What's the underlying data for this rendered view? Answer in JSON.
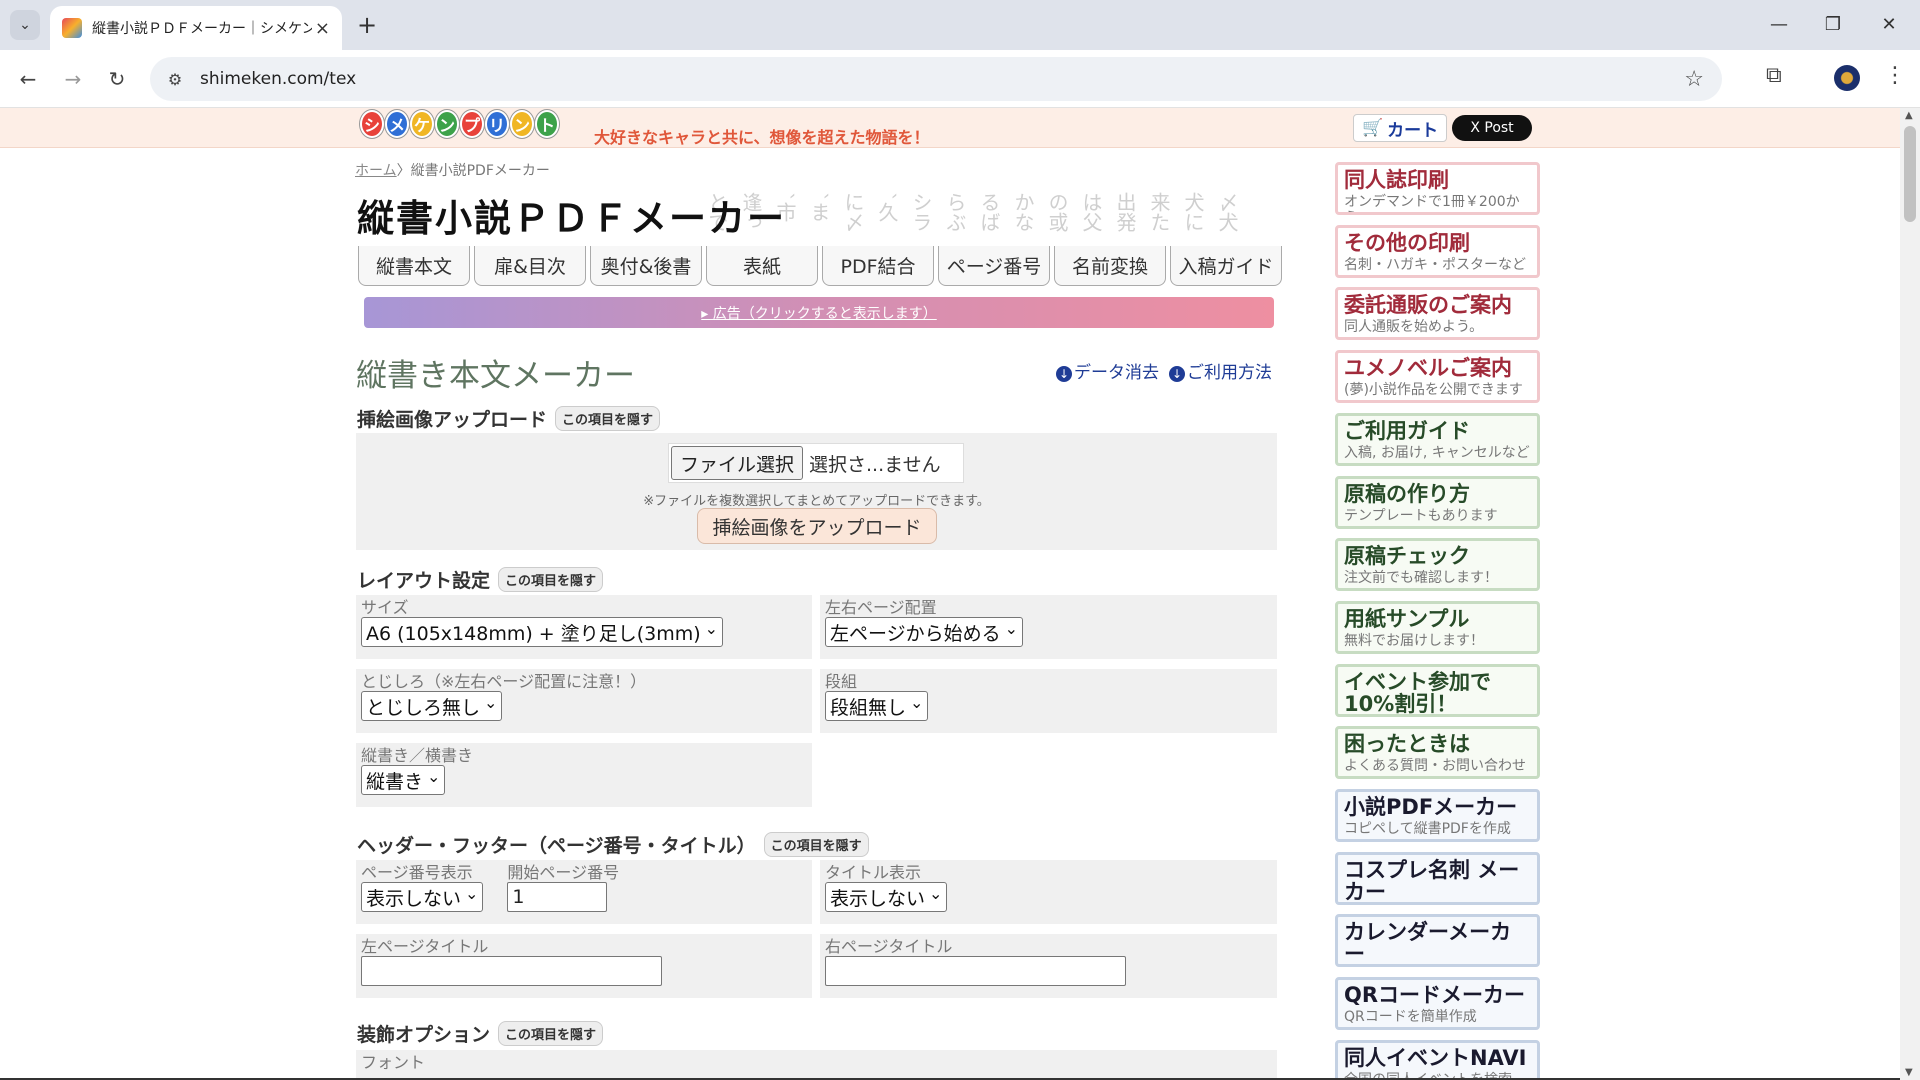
{
  "browser": {
    "tab_title": "縦書小説ＰＤＦメーカー｜シメケン",
    "url": "shimeken.com/tex"
  },
  "header": {
    "logo_letters": [
      "シ",
      "メ",
      "ケ",
      "ン",
      "プ",
      "リ",
      "ン",
      "ト"
    ],
    "logo_colors": [
      "#e8423a",
      "#2f6fd6",
      "#f0b624",
      "#3da24a",
      "#e8423a",
      "#2f6fd6",
      "#f0b624",
      "#3da24a"
    ],
    "tagline": "大好きなキャラと共に、想像を超えた物語を！",
    "cart_label": "カート",
    "post_label": "X Post"
  },
  "breadcrumb": {
    "home": "ホーム",
    "separator": "〉",
    "current": "縦書小説PDFメーカー"
  },
  "page_title": "縦書小説ＰＤＦメーカー",
  "main_tabs": [
    "縦書本文",
    "扉&目次",
    "奥付&後書",
    "表紙",
    "PDF結合",
    "ページ番号",
    "名前変換",
    "入稿ガイド"
  ],
  "ad_bar": "▸ 広告（クリックすると表示します）",
  "section_title": "縦書き本文メーカー",
  "top_links": {
    "clear_data": "データ消去",
    "how_to_use": "ご利用方法"
  },
  "hide_label": "この項目を隠す",
  "upload": {
    "heading": "挿絵画像アップロード",
    "file_button": "ファイル選択",
    "file_status": "選択さ...ません",
    "note": "※ファイルを複数選択してまとめてアップロードできます。",
    "upload_button": "挿絵画像をアップロード"
  },
  "layout": {
    "heading": "レイアウト設定",
    "size_label": "サイズ",
    "size_value": "A6 (105x148mm) + 塗り足し(3mm)",
    "page_side_label": "左右ページ配置",
    "page_side_value": "左ページから始める",
    "binding_label": "とじしろ（※左右ページ配置に注意！）",
    "binding_value": "とじしろ無し",
    "columns_label": "段組",
    "columns_value": "段組無し",
    "direction_label": "縦書き／横書き",
    "direction_value": "縦書き"
  },
  "header_footer": {
    "heading": "ヘッダー・フッター（ページ番号・タイトル）",
    "page_number_label": "ページ番号表示",
    "page_number_value": "表示しない",
    "start_page_label": "開始ページ番号",
    "start_page_value": "1",
    "title_display_label": "タイトル表示",
    "title_display_value": "表示しない",
    "left_title_label": "左ページタイトル",
    "right_title_label": "右ページタイトル"
  },
  "decoration": {
    "heading": "装飾オプション",
    "font_label": "フォント"
  },
  "sidebar": [
    {
      "main": "同人誌印刷",
      "sub": "オンデマンドで1冊￥200から",
      "style": "red"
    },
    {
      "main": "その他の印刷",
      "sub": "名刺・ハガキ・ポスターなど",
      "style": "red"
    },
    {
      "main": "委託通販のご案内",
      "sub": "同人通販を始めよう。",
      "style": "red"
    },
    {
      "main": "ユメノベルご案内",
      "sub": "(夢)小説作品を公開できます",
      "style": "red"
    },
    {
      "main": "ご利用ガイド",
      "sub": "入稿, お届け, キャンセルなど",
      "style": "green"
    },
    {
      "main": "原稿の作り方",
      "sub": "テンプレートもあります",
      "style": "green"
    },
    {
      "main": "原稿チェック",
      "sub": "注文前でも確認します！",
      "style": "green"
    },
    {
      "main": "用紙サンプル",
      "sub": "無料でお届けします！",
      "style": "green"
    },
    {
      "main": "イベント参加で 10%割引！",
      "sub": "",
      "style": "green"
    },
    {
      "main": "困ったときは",
      "sub": "よくある質問・お問い合わせ",
      "style": "green"
    },
    {
      "main": "小説PDFメーカー",
      "sub": "コピペして縦書PDFを作成",
      "style": "blue"
    },
    {
      "main": "コスプレ名刺 メーカー",
      "sub": "",
      "style": "blue"
    },
    {
      "main": "カレンダーメーカー",
      "sub": "カレンダー画像を簡単作成",
      "style": "blue"
    },
    {
      "main": "QRコードメーカー",
      "sub": "QRコードを簡単作成",
      "style": "blue"
    },
    {
      "main": "同人イベントNAVI",
      "sub": "全国の同人イベントを検索",
      "style": "blue"
    }
  ],
  "bg_text": [
    "とで",
    "逢っ",
    "`市",
    "`ま",
    "に〆",
    "`久",
    "シラ",
    "らぶ",
    "るば",
    "かな",
    "の或",
    "は父",
    "出発",
    "来た",
    "犬に",
    "〆犬"
  ]
}
